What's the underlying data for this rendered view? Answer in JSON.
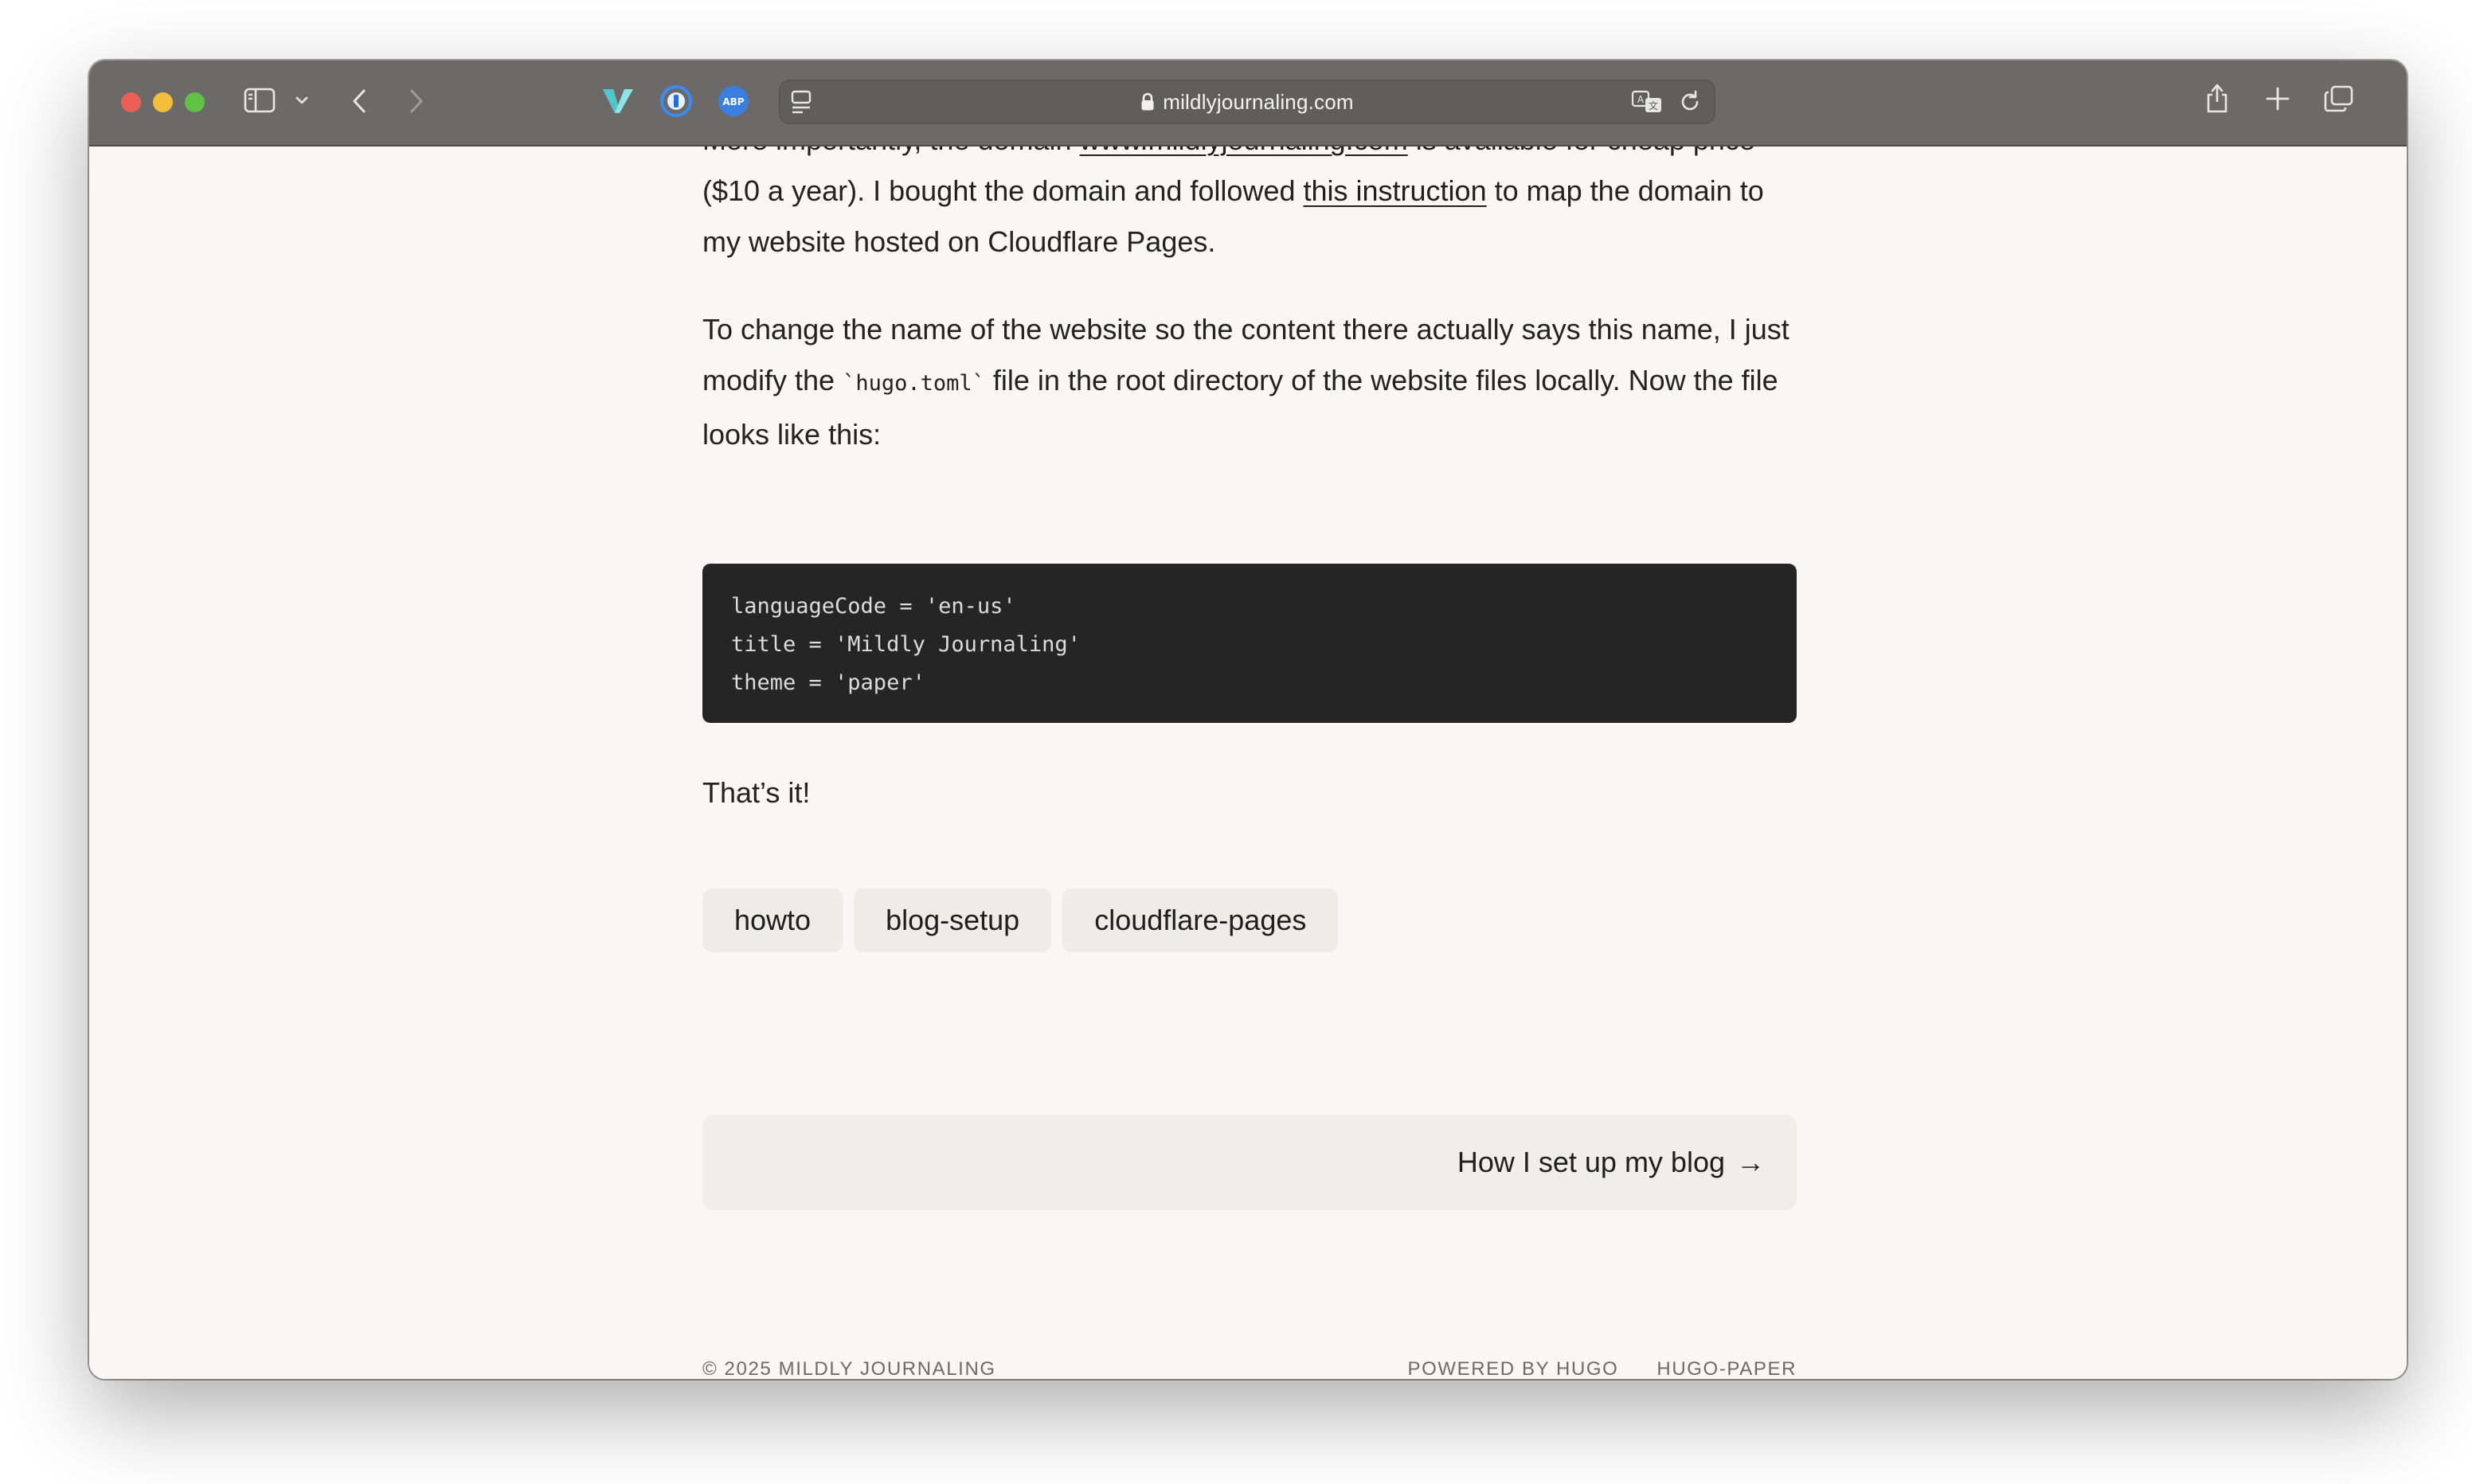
{
  "browser": {
    "url": "mildlyjournaling.com",
    "colors": {
      "toolbar": "#6b6a68",
      "page_background": "#f8f7f3"
    }
  },
  "article": {
    "para1_cut": {
      "lead": "More importantly, the domain ",
      "domain_link": "www.mildlyjournaling.com",
      "tail": " is available for cheap price"
    },
    "para1": {
      "before": "($10 a year). I bought the domain and followed ",
      "link": "this instruction",
      "after": " to map the domain to my website hosted on Cloudflare Pages."
    },
    "para2": {
      "before": "To change the name of the website so the content there actually says this name, I just modify the ",
      "code": "`hugo.toml`",
      "after": " file in the root directory of the website files locally. Now the file looks like this:"
    },
    "code_lines": [
      "languageCode = 'en-us'",
      "title = 'Mildly Journaling'",
      "theme = 'paper'"
    ],
    "closing": "That’s it!"
  },
  "tags": [
    "howto",
    "blog-setup",
    "cloudflare-pages"
  ],
  "next_post": {
    "label": "How I set up my blog",
    "arrow": "→"
  },
  "footer": {
    "copyright": "© 2025 MILDLY JOURNALING",
    "powered": "POWERED BY HUGO",
    "theme": "HUGO-PAPER"
  }
}
